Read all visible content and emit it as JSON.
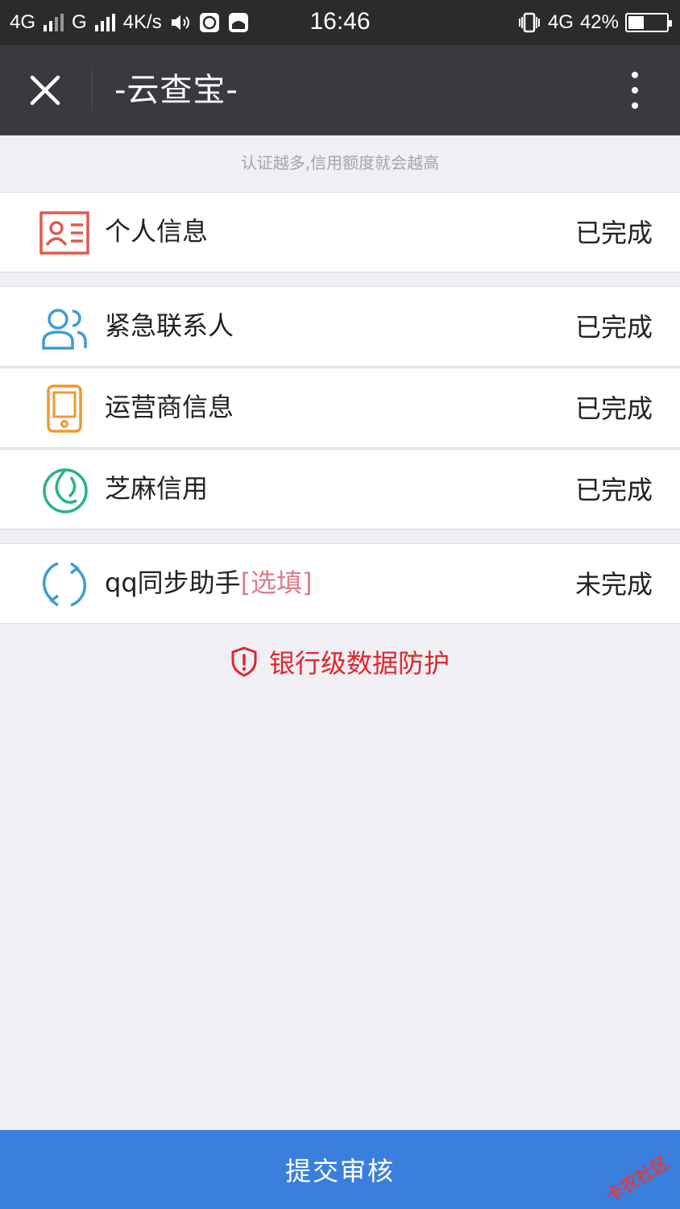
{
  "status_bar": {
    "net1": "4G",
    "net2": "G",
    "speed": "4K/s",
    "time": "16:46",
    "net3": "4G",
    "battery": "42%",
    "battery_level": 0.42
  },
  "header": {
    "title": "-云查宝-",
    "close_icon": "close-icon",
    "more_icon": "more-vertical-icon"
  },
  "hint": "认证越多,信用额度就会越高",
  "items": [
    {
      "label": "个人信息",
      "optional": "",
      "status": "已完成",
      "icon": "id-card-icon",
      "color": "#e05a4f"
    },
    {
      "label": "紧急联系人",
      "optional": "",
      "status": "已完成",
      "icon": "contacts-icon",
      "color": "#3e9cd6"
    },
    {
      "label": "运营商信息",
      "optional": "",
      "status": "已完成",
      "icon": "phone-icon",
      "color": "#ef9a2c"
    },
    {
      "label": "芝麻信用",
      "optional": "",
      "status": "已完成",
      "icon": "sesame-icon",
      "color": "#2bb47e"
    },
    {
      "label": "qq同步助手",
      "optional": "[选填]",
      "status": "未完成",
      "icon": "sync-icon",
      "color": "#3e9cd6"
    }
  ],
  "security": {
    "text": "银行级数据防护",
    "icon": "shield-icon",
    "color": "#e0262c"
  },
  "submit": {
    "label": "提交审核",
    "color": "#3a7fde"
  },
  "watermark": "卡农社区"
}
